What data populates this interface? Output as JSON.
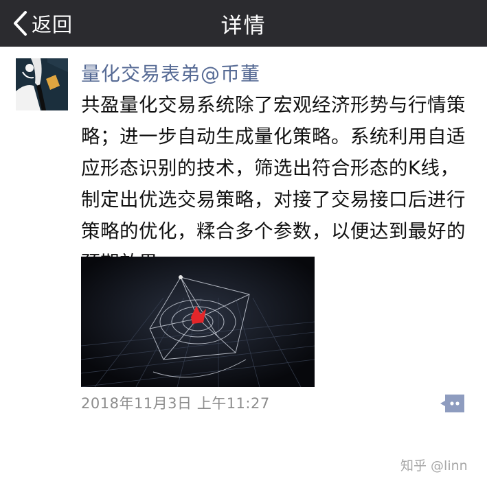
{
  "nav": {
    "back_label": "返回",
    "title": "详情",
    "background": "#2b2b2f"
  },
  "post": {
    "author": "量化交易表弟@币董",
    "author_color": "#576b95",
    "body": "共盈量化交易系统除了宏观经济形势与行情策略；进一步自动生成量化策略。系统利用自适应形态识别的技术，筛选出符合形态的K线，制定出优选交易策略，对接了交易接口后进行策略的优化，糅合多个参数，以便达到最好的预期效果",
    "timestamp": "2018年11月3日 上午11:27",
    "comment_icon": "comment-bubble-icon"
  },
  "watermark": "知乎 @linn"
}
